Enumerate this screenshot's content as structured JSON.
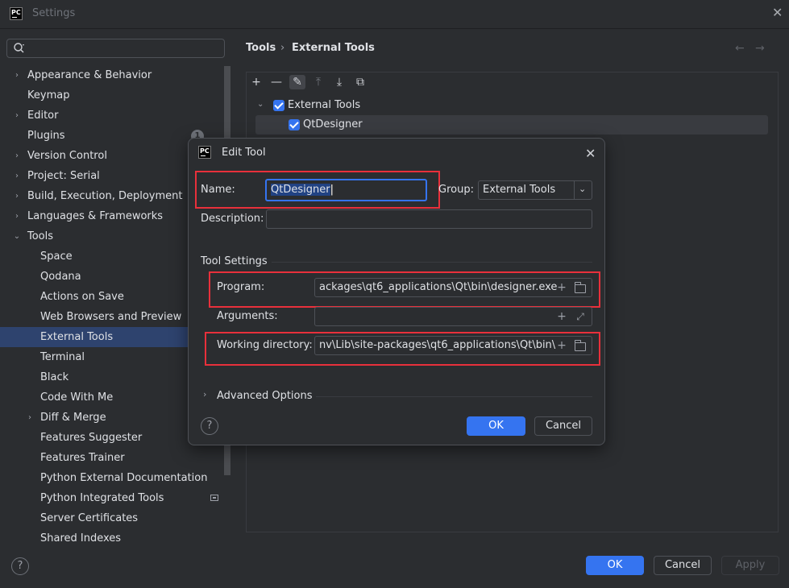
{
  "window": {
    "title": "Settings",
    "close_glyph": "✕"
  },
  "search": {
    "placeholder": "",
    "icon": "search-icon"
  },
  "tree": [
    {
      "label": "Appearance & Behavior",
      "level": 0,
      "expandable": true,
      "expanded": false
    },
    {
      "label": "Keymap",
      "level": 0,
      "expandable": false
    },
    {
      "label": "Editor",
      "level": 0,
      "expandable": true,
      "expanded": false
    },
    {
      "label": "Plugins",
      "level": 0,
      "expandable": false,
      "badge": "1"
    },
    {
      "label": "Version Control",
      "level": 0,
      "expandable": true,
      "expanded": false
    },
    {
      "label": "Project: Serial",
      "level": 0,
      "expandable": true,
      "expanded": false
    },
    {
      "label": "Build, Execution, Deployment",
      "level": 0,
      "expandable": true,
      "expanded": false
    },
    {
      "label": "Languages & Frameworks",
      "level": 0,
      "expandable": true,
      "expanded": false
    },
    {
      "label": "Tools",
      "level": 0,
      "expandable": true,
      "expanded": true
    },
    {
      "label": "Space",
      "level": 1,
      "expandable": false
    },
    {
      "label": "Qodana",
      "level": 1,
      "expandable": false
    },
    {
      "label": "Actions on Save",
      "level": 1,
      "expandable": false
    },
    {
      "label": "Web Browsers and Preview",
      "level": 1,
      "expandable": false
    },
    {
      "label": "External Tools",
      "level": 1,
      "expandable": false,
      "selected": true
    },
    {
      "label": "Terminal",
      "level": 1,
      "expandable": false
    },
    {
      "label": "Black",
      "level": 1,
      "expandable": false
    },
    {
      "label": "Code With Me",
      "level": 1,
      "expandable": false
    },
    {
      "label": "Diff & Merge",
      "level": 1,
      "expandable": true,
      "expanded": false
    },
    {
      "label": "Features Suggester",
      "level": 1,
      "expandable": false
    },
    {
      "label": "Features Trainer",
      "level": 1,
      "expandable": false
    },
    {
      "label": "Python External Documentation",
      "level": 1,
      "expandable": false
    },
    {
      "label": "Python Integrated Tools",
      "level": 1,
      "expandable": false,
      "trailing_icon": "project-level-icon"
    },
    {
      "label": "Server Certificates",
      "level": 1,
      "expandable": false
    },
    {
      "label": "Shared Indexes",
      "level": 1,
      "expandable": false
    }
  ],
  "breadcrumb": {
    "parent": "Tools",
    "separator": "›",
    "current": "External Tools",
    "back": "←",
    "forward": "→"
  },
  "toolbar": {
    "add": "+",
    "remove": "—",
    "edit": "✎",
    "move_up": "⤒",
    "move_down": "⤓",
    "copy": "⧉"
  },
  "tools_tree": {
    "group_label": "External Tools",
    "group_checked": true,
    "item_label": "QtDesigner",
    "item_checked": true
  },
  "dialog": {
    "title": "Edit Tool",
    "close": "✕",
    "name_label": "Name:",
    "name_value": "QtDesigner",
    "group_label": "Group:",
    "group_value": "External Tools",
    "description_label": "Description:",
    "description_value": "",
    "tool_settings_label": "Tool Settings",
    "program_label": "Program:",
    "program_value": "ackages\\qt6_applications\\Qt\\bin\\designer.exe",
    "arguments_label": "Arguments:",
    "arguments_value": "",
    "workdir_label": "Working directory:",
    "workdir_value": "nv\\Lib\\site-packages\\qt6_applications\\Qt\\bin\\",
    "advanced_label": "Advanced Options",
    "help": "?",
    "ok": "OK",
    "cancel": "Cancel"
  },
  "footer": {
    "help": "?",
    "ok": "OK",
    "cancel": "Cancel",
    "apply": "Apply"
  },
  "colors": {
    "accent": "#3574f0",
    "highlight_box": "#e8303b",
    "selection": "#2e436e"
  }
}
